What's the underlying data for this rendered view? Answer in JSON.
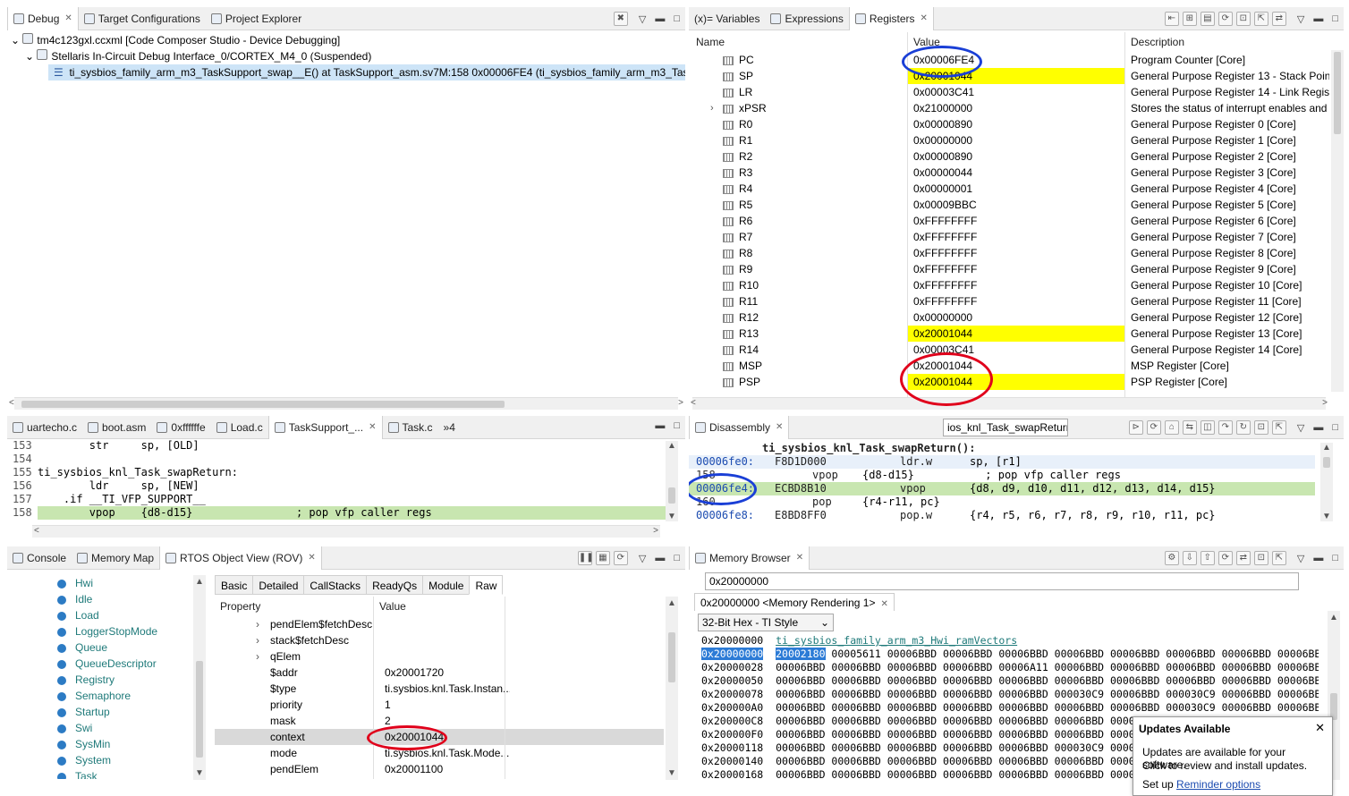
{
  "debug": {
    "tabs": [
      "Debug",
      "Target Configurations",
      "Project Explorer"
    ],
    "tree": [
      "tm4c123gxl.ccxml [Code Composer Studio - Device Debugging]",
      "Stellaris In-Circuit Debug Interface_0/CORTEX_M4_0 (Suspended)",
      "ti_sysbios_family_arm_m3_TaskSupport_swap__E() at TaskSupport_asm.sv7M:158 0x00006FE4  (ti_sysbios_family_arm_m3_TaskSupp"
    ]
  },
  "registers": {
    "tabs": [
      "(x)= Variables",
      "Expressions",
      "Registers"
    ],
    "columns": [
      "Name",
      "Value",
      "Description"
    ],
    "rows": [
      {
        "name": "PC",
        "value": "0x00006FE4",
        "desc": "Program Counter [Core]",
        "hl": false
      },
      {
        "name": "SP",
        "value": "0x20001044",
        "desc": "General Purpose Register 13 - Stack Pointe",
        "hl": true
      },
      {
        "name": "LR",
        "value": "0x00003C41",
        "desc": "General Purpose Register 14 - Link Register",
        "hl": false
      },
      {
        "name": "xPSR",
        "value": "0x21000000",
        "desc": "Stores the status of interrupt enables and c",
        "hl": false,
        "expand": true
      },
      {
        "name": "R0",
        "value": "0x00000890",
        "desc": "General Purpose Register 0 [Core]",
        "hl": false
      },
      {
        "name": "R1",
        "value": "0x00000000",
        "desc": "General Purpose Register 1 [Core]",
        "hl": false
      },
      {
        "name": "R2",
        "value": "0x00000890",
        "desc": "General Purpose Register 2 [Core]",
        "hl": false
      },
      {
        "name": "R3",
        "value": "0x00000044",
        "desc": "General Purpose Register 3 [Core]",
        "hl": false
      },
      {
        "name": "R4",
        "value": "0x00000001",
        "desc": "General Purpose Register 4 [Core]",
        "hl": false
      },
      {
        "name": "R5",
        "value": "0x00009BBC",
        "desc": "General Purpose Register 5 [Core]",
        "hl": false
      },
      {
        "name": "R6",
        "value": "0xFFFFFFFF",
        "desc": "General Purpose Register 6 [Core]",
        "hl": false
      },
      {
        "name": "R7",
        "value": "0xFFFFFFFF",
        "desc": "General Purpose Register 7 [Core]",
        "hl": false
      },
      {
        "name": "R8",
        "value": "0xFFFFFFFF",
        "desc": "General Purpose Register 8 [Core]",
        "hl": false
      },
      {
        "name": "R9",
        "value": "0xFFFFFFFF",
        "desc": "General Purpose Register 9 [Core]",
        "hl": false
      },
      {
        "name": "R10",
        "value": "0xFFFFFFFF",
        "desc": "General Purpose Register 10 [Core]",
        "hl": false
      },
      {
        "name": "R11",
        "value": "0xFFFFFFFF",
        "desc": "General Purpose Register 11 [Core]",
        "hl": false
      },
      {
        "name": "R12",
        "value": "0x00000000",
        "desc": "General Purpose Register 12 [Core]",
        "hl": false
      },
      {
        "name": "R13",
        "value": "0x20001044",
        "desc": "General Purpose Register 13 [Core]",
        "hl": true
      },
      {
        "name": "R14",
        "value": "0x00003C41",
        "desc": "General Purpose Register 14 [Core]",
        "hl": false
      },
      {
        "name": "MSP",
        "value": "0x20001044",
        "desc": "MSP Register [Core]",
        "hl": false
      },
      {
        "name": "PSP",
        "value": "0x20001044",
        "desc": "PSP Register [Core]",
        "hl": true
      }
    ]
  },
  "editor": {
    "tabs": [
      "uartecho.c",
      "boot.asm",
      "0xffffffe",
      "Load.c",
      "TaskSupport_...",
      "Task.c",
      "»4"
    ],
    "lines": [
      {
        "num": "153",
        "text": "        str     sp, [OLD]"
      },
      {
        "num": "154",
        "text": ""
      },
      {
        "num": "155",
        "text": "ti_sysbios_knl_Task_swapReturn:"
      },
      {
        "num": "156",
        "text": "        ldr     sp, [NEW]"
      },
      {
        "num": "157",
        "text": "    .if __TI_VFP_SUPPORT__"
      },
      {
        "num": "158",
        "text": "        vpop    {d8-d15}                ; pop vfp caller regs"
      }
    ]
  },
  "disassembly": {
    "title": "Disassembly",
    "location": "ios_knl_Task_swapReturn",
    "label": "ti_sysbios_knl_Task_swapReturn():",
    "lines": [
      {
        "addr": "00006fe0:",
        "op": "F8D1D000",
        "mn": "ldr.w",
        "args": "sp, [r1]",
        "sel": true
      },
      {
        "addr": "158",
        "op": "",
        "mn": "vpop",
        "args": "{d8-d15}           ; pop vfp caller regs",
        "src": true
      },
      {
        "addr": "00006fe4:",
        "op": "ECBD8B10",
        "mn": "vpop",
        "args": "{d8, d9, d10, d11, d12, d13, d14, d15}",
        "cur": true
      },
      {
        "addr": "160",
        "op": "",
        "mn": "pop",
        "args": "{r4-r11, pc}",
        "src": true
      },
      {
        "addr": "00006fe8:",
        "op": "E8BD8FF0",
        "mn": "pop.w",
        "args": "{r4, r5, r6, r7, r8, r9, r10, r11, pc}"
      }
    ]
  },
  "rov": {
    "tabs": [
      "Console",
      "Memory Map",
      "RTOS Object View (ROV)"
    ],
    "modules": [
      "Hwi",
      "Idle",
      "Load",
      "LoggerStopMode",
      "Queue",
      "QueueDescriptor",
      "Registry",
      "Semaphore",
      "Startup",
      "Swi",
      "SysMin",
      "System",
      "Task"
    ],
    "subtabs": [
      "Basic",
      "Detailed",
      "CallStacks",
      "ReadyQs",
      "Module",
      "Raw"
    ],
    "columns": [
      "Property",
      "Value"
    ],
    "props": [
      {
        "name": "pendElem$fetchDesc",
        "value": "",
        "expand": true
      },
      {
        "name": "stack$fetchDesc",
        "value": "",
        "expand": true
      },
      {
        "name": "qElem",
        "value": "",
        "expand": true
      },
      {
        "name": "$addr",
        "value": "0x20001720"
      },
      {
        "name": "$type",
        "value": "ti.sysbios.knl.Task.Instan..."
      },
      {
        "name": "priority",
        "value": "1"
      },
      {
        "name": "mask",
        "value": "2"
      },
      {
        "name": "context",
        "value": "0x20001044",
        "sel": true
      },
      {
        "name": "mode",
        "value": "ti.sysbios.knl.Task.Mode..."
      },
      {
        "name": "pendElem",
        "value": "0x20001100"
      }
    ]
  },
  "memory": {
    "title": "Memory Browser",
    "address_input": "0x20000000",
    "rendering_tab": "0x20000000 <Memory Rendering 1>",
    "format": "32-Bit Hex - TI Style",
    "symbol": "ti_sysbios_family_arm_m3_Hwi_ramVectors",
    "header_addr": "0x20000000",
    "rows": [
      {
        "addr": "0x20000000",
        "data": "20002180 00005611 00006BBD 00006BBD 00006BBD 00006BBD 00006BBD 00006BBD 00006BBD 00006BBD"
      },
      {
        "addr": "0x20000028",
        "data": "00006BBD 00006BBD 00006BBD 00006BBD 00006A11 00006BBD 00006BBD 00006BBD 00006BBD 00006BBD"
      },
      {
        "addr": "0x20000050",
        "data": "00006BBD 00006BBD 00006BBD 00006BBD 00006BBD 00006BBD 00006BBD 00006BBD 00006BBD 00006BBD"
      },
      {
        "addr": "0x20000078",
        "data": "00006BBD 00006BBD 00006BBD 00006BBD 00006BBD 000030C9 00006BBD 000030C9 00006BBD 00006BBD"
      },
      {
        "addr": "0x200000A0",
        "data": "00006BBD 00006BBD 00006BBD 00006BBD 00006BBD 00006BBD 00006BBD 000030C9 00006BBD 00006BBD"
      },
      {
        "addr": "0x200000C8",
        "data": "00006BBD 00006BBD 00006BBD 00006BBD 00006BBD 00006BBD 00006BBD 00006E"
      },
      {
        "addr": "0x200000F0",
        "data": "00006BBD 00006BBD 00006BBD 00006BBD 00006BBD 00006BBD 00006BBD 00006E"
      },
      {
        "addr": "0x20000118",
        "data": "00006BBD 00006BBD 00006BBD 00006BBD 00006BBD 000030C9 00006BBD 00006E"
      },
      {
        "addr": "0x20000140",
        "data": "00006BBD 00006BBD 00006BBD 00006BBD 00006BBD 00006BBD 00006BBD 00006E"
      },
      {
        "addr": "0x20000168",
        "data": "00006BBD 00006BBD 00006BBD 00006BBD 00006BBD 00006BBD 00006BBD 00006E"
      }
    ]
  },
  "updates": {
    "title": "Updates Available",
    "line1": "Updates are available for your software.",
    "line2": "Click to review and install updates.",
    "setup": "Set up",
    "link": "Reminder options"
  },
  "colors": {
    "highlight": "#ffff00",
    "annotation_red": "#e0001b",
    "annotation_blue": "#1a3fd6"
  }
}
